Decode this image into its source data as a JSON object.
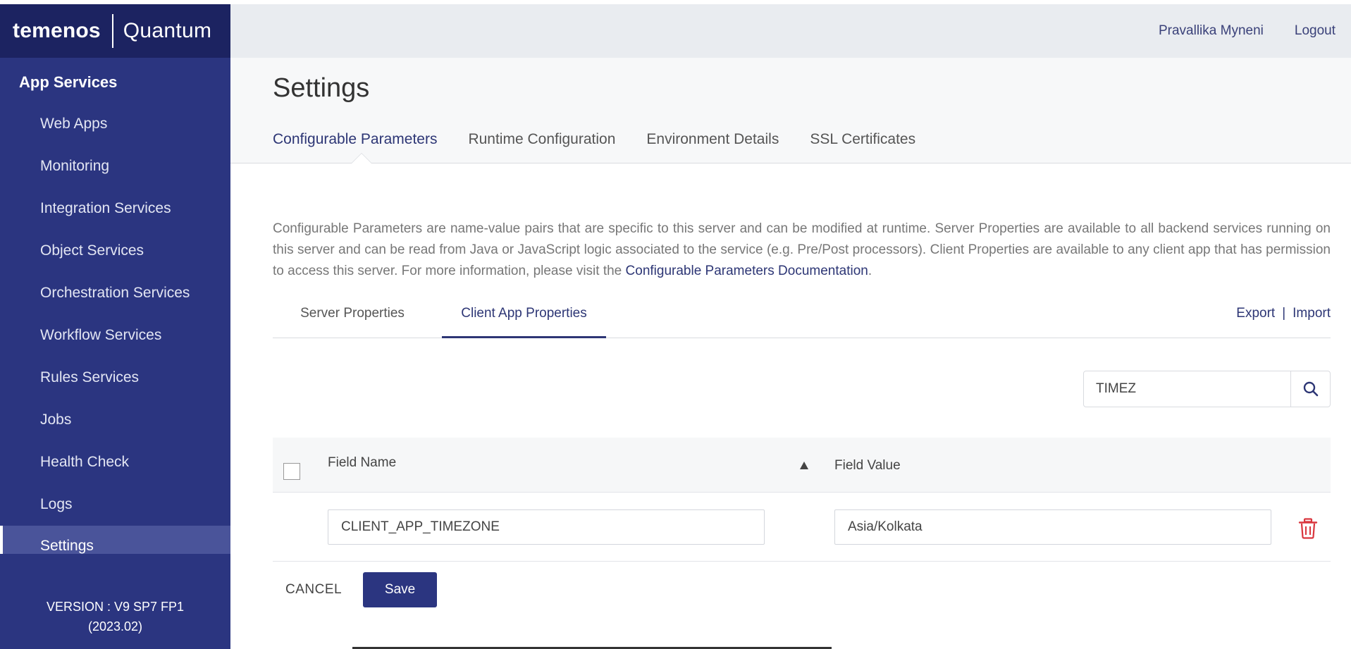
{
  "brand": {
    "main": "temenos",
    "sub": "Quantum"
  },
  "sidebar": {
    "section_title": "App Services",
    "items": [
      {
        "label": "Web Apps"
      },
      {
        "label": "Monitoring"
      },
      {
        "label": "Integration Services"
      },
      {
        "label": "Object Services"
      },
      {
        "label": "Orchestration Services"
      },
      {
        "label": "Workflow Services"
      },
      {
        "label": "Rules Services"
      },
      {
        "label": "Jobs"
      },
      {
        "label": "Health Check"
      },
      {
        "label": "Logs"
      },
      {
        "label": "Settings",
        "active": true
      }
    ],
    "version_line1": "VERSION : V9 SP7 FP1",
    "version_line2": "(2023.02)"
  },
  "header": {
    "user_name": "Pravallika Myneni",
    "logout_label": "Logout"
  },
  "page": {
    "title": "Settings",
    "tabs": [
      {
        "label": "Configurable Parameters",
        "active": true
      },
      {
        "label": "Runtime Configuration"
      },
      {
        "label": "Environment Details"
      },
      {
        "label": "SSL Certificates"
      }
    ]
  },
  "description": {
    "text": "Configurable Parameters are name-value pairs that are specific to this server and can be modified at runtime. Server Properties are available to all backend services running on this server and can be read from Java or JavaScript logic associated to the service (e.g. Pre/Post processors). Client Properties are available to any client app that has permission to access this server. For more information, please visit the ",
    "link_text": "Configurable Parameters Documentation",
    "suffix": "."
  },
  "subtabs": [
    {
      "label": "Server Properties"
    },
    {
      "label": "Client App Properties",
      "active": true
    }
  ],
  "export_label": "Export",
  "import_label": "Import",
  "separator": "|",
  "search": {
    "value": "TIMEZ"
  },
  "table": {
    "columns": {
      "name": "Field Name",
      "value": "Field Value"
    },
    "rows": [
      {
        "name": "CLIENT_APP_TIMEZONE",
        "value": "Asia/Kolkata"
      }
    ]
  },
  "actions": {
    "cancel_label": "CANCEL",
    "save_label": "Save"
  },
  "colors": {
    "sidebar": "#2b3580",
    "brand_bar": "#1c2361",
    "accent": "#2d3675",
    "danger": "#d9363e"
  }
}
